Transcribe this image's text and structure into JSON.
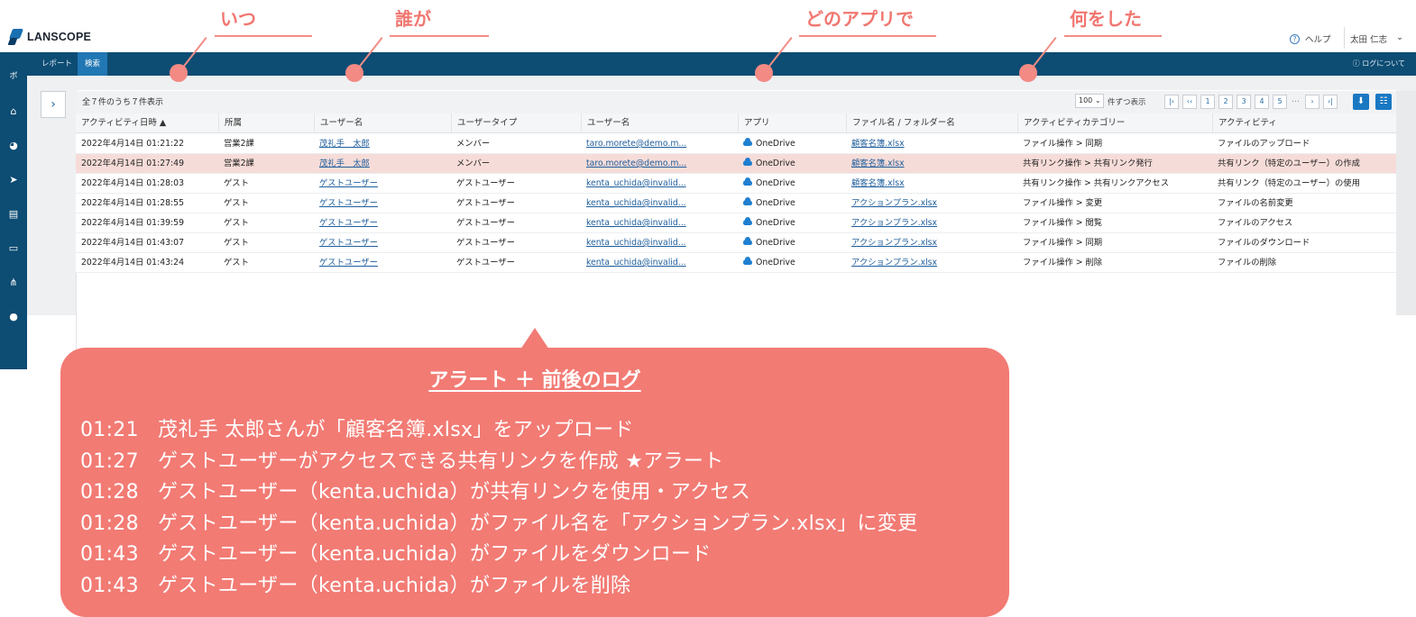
{
  "annotations": [
    {
      "label": "いつ"
    },
    {
      "label": "誰が"
    },
    {
      "label": "どのアプリで"
    },
    {
      "label": "何をした"
    }
  ],
  "header": {
    "logo": "LANSCOPE",
    "help": "ヘルプ",
    "user": "太田 仁志",
    "user_caret": "⌄"
  },
  "nav": {
    "tabs": [
      "レポート",
      "検索"
    ],
    "active_tab": "検索",
    "logs_link": "ログについて"
  },
  "sidebar": {
    "icons": [
      "ボ",
      "home-icon",
      "dashboard-icon",
      "send-icon",
      "chat-icon",
      "message-icon",
      "network-icon",
      "user-icon"
    ]
  },
  "table_toolbar": {
    "count_text": "全７件のうち７件表示",
    "per_page": "100",
    "per_page_label": "件ずつ表示",
    "pages": [
      "1",
      "2",
      "3",
      "4",
      "5"
    ],
    "ellipsis": "…"
  },
  "table": {
    "columns": [
      "アクティビティ日時 ▲",
      "所属",
      "ユーザー名",
      "ユーザータイプ",
      "ユーザー名",
      "アプリ",
      "ファイル名 / フォルダー名",
      "アクティビティカテゴリー",
      "アクティビティ"
    ],
    "rows": [
      [
        "2022年4月14日 01:21:22",
        "営業2課",
        "茂礼手　太郎",
        "メンバー",
        "taro.morete@demo.m...",
        "OneDrive",
        "顧客名簿.xlsx",
        "ファイル操作 > 同期",
        "ファイルのアップロード"
      ],
      [
        "2022年4月14日 01:27:49",
        "営業2課",
        "茂礼手　太郎",
        "メンバー",
        "taro.morete@demo.m...",
        "OneDrive",
        "顧客名簿.xlsx",
        "共有リンク操作 > 共有リンク発行",
        "共有リンク（特定のユーザー）の作成"
      ],
      [
        "2022年4月14日 01:28:03",
        "ゲスト",
        "ゲストユーザー",
        "ゲストユーザー",
        "kenta_uchida@invalid...",
        "OneDrive",
        "顧客名簿.xlsx",
        "共有リンク操作 > 共有リンクアクセス",
        "共有リンク（特定のユーザー）の使用"
      ],
      [
        "2022年4月14日 01:28:55",
        "ゲスト",
        "ゲストユーザー",
        "ゲストユーザー",
        "kenta_uchida@invalid...",
        "OneDrive",
        "アクションプラン.xlsx",
        "ファイル操作 > 変更",
        "ファイルの名前変更"
      ],
      [
        "2022年4月14日 01:39:59",
        "ゲスト",
        "ゲストユーザー",
        "ゲストユーザー",
        "kenta_uchida@invalid...",
        "OneDrive",
        "アクションプラン.xlsx",
        "ファイル操作 > 閲覧",
        "ファイルのアクセス"
      ],
      [
        "2022年4月14日 01:43:07",
        "ゲスト",
        "ゲストユーザー",
        "ゲストユーザー",
        "kenta_uchida@invalid...",
        "OneDrive",
        "アクションプラン.xlsx",
        "ファイル操作 > 同期",
        "ファイルのダウンロード"
      ],
      [
        "2022年4月14日 01:43:24",
        "ゲスト",
        "ゲストユーザー",
        "ゲストユーザー",
        "kenta_uchida@invalid...",
        "OneDrive",
        "アクションプラン.xlsx",
        "ファイル操作 > 削除",
        "ファイルの削除"
      ]
    ],
    "highlighted_row": 1
  },
  "callout": {
    "title": "アラート ＋ 前後のログ",
    "lines": [
      {
        "time": "01:21",
        "text": "茂礼手 太郎さんが「顧客名簿.xlsx」をアップロード"
      },
      {
        "time": "01:27",
        "text": "ゲストユーザーがアクセスできる共有リンクを作成 ★アラート"
      },
      {
        "time": "01:28",
        "text": "ゲストユーザー（kenta.uchida）が共有リンクを使用・アクセス"
      },
      {
        "time": "01:28",
        "text": "ゲストユーザー（kenta.uchida）がファイル名を「アクションプラン.xlsx」に変更"
      },
      {
        "time": "01:43",
        "text": "ゲストユーザー（kenta.uchida）がファイルをダウンロード"
      },
      {
        "time": "01:43",
        "text": "ゲストユーザー（kenta.uchida）がファイルを削除"
      }
    ]
  },
  "colors": {
    "accent": "#f27b74",
    "nav": "#0d4c73",
    "alert_row": "#f6dcd8",
    "link": "#1f5e9c"
  }
}
